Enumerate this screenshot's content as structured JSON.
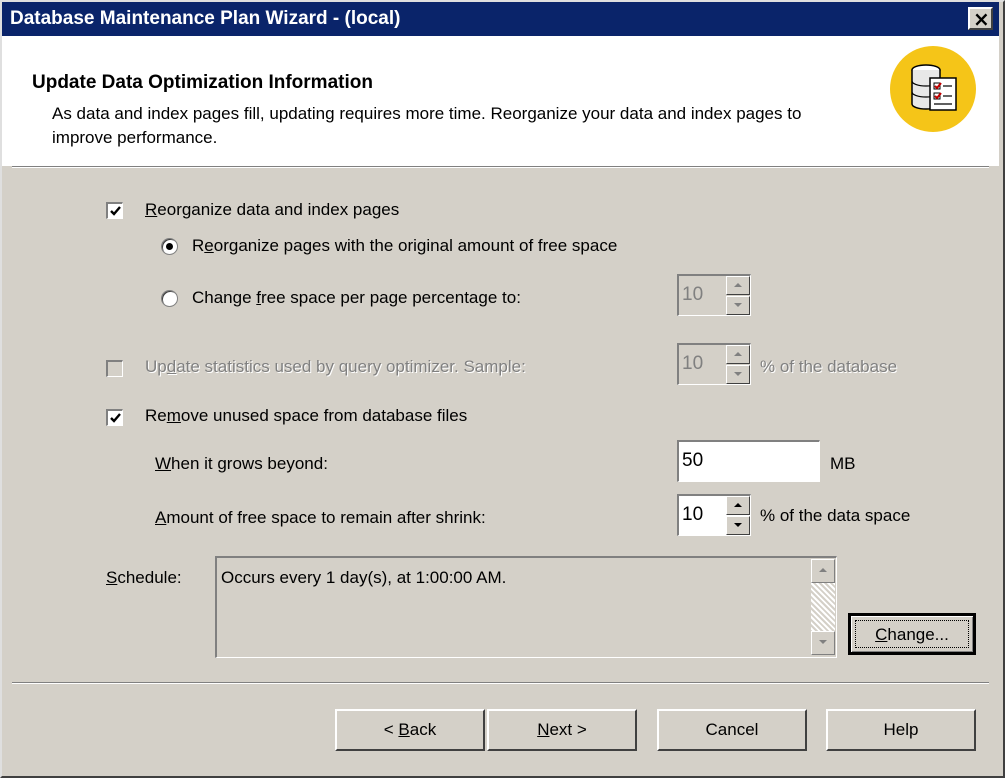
{
  "window": {
    "title": "Database Maintenance Plan Wizard - (local)",
    "close_glyph": "×"
  },
  "header": {
    "title": "Update Data Optimization Information",
    "description": "As data and index pages fill, updating requires more time. Reorganize your data and index pages to improve performance.",
    "icon": "database-checklist-icon"
  },
  "reorganize": {
    "checked": true,
    "label_pre": "",
    "label_mnemonic": "R",
    "label_post": "eorganize data and index pages",
    "option_original": {
      "selected": true,
      "label_pre": "R",
      "label_mnemonic": "e",
      "label_post": "organize pages with the original amount of free space"
    },
    "option_change": {
      "selected": false,
      "label_pre": "Change ",
      "label_mnemonic": "f",
      "label_post": "ree space per page percentage to:",
      "value": "10"
    }
  },
  "update_stats": {
    "checked": false,
    "enabled": false,
    "label_pre": "Up",
    "label_mnemonic": "d",
    "label_post": "ate statistics used by query optimizer. Sample:",
    "value": "10",
    "suffix": "% of the database"
  },
  "remove_unused": {
    "checked": true,
    "label_pre": "Re",
    "label_mnemonic": "m",
    "label_post": "ove unused space from database files",
    "grows_label_pre": "",
    "grows_label_mnemonic": "W",
    "grows_label_post": "hen it grows beyond:",
    "grows_value": "50",
    "grows_unit": "MB",
    "free_label_pre": "",
    "free_label_mnemonic": "A",
    "free_label_post": "mount of free space to remain after shrink:",
    "free_value": "10",
    "free_suffix": "% of the data space"
  },
  "schedule": {
    "label_pre": "",
    "label_mnemonic": "S",
    "label_post": "chedule:",
    "text": "Occurs every 1 day(s), at 1:00:00 AM.",
    "change_pre": "",
    "change_mnemonic": "C",
    "change_post": "hange..."
  },
  "buttons": {
    "back_pre": "< ",
    "back_mnemonic": "B",
    "back_post": "ack",
    "next_pre": "",
    "next_mnemonic": "N",
    "next_post": "ext >",
    "cancel": "Cancel",
    "help": "Help"
  }
}
